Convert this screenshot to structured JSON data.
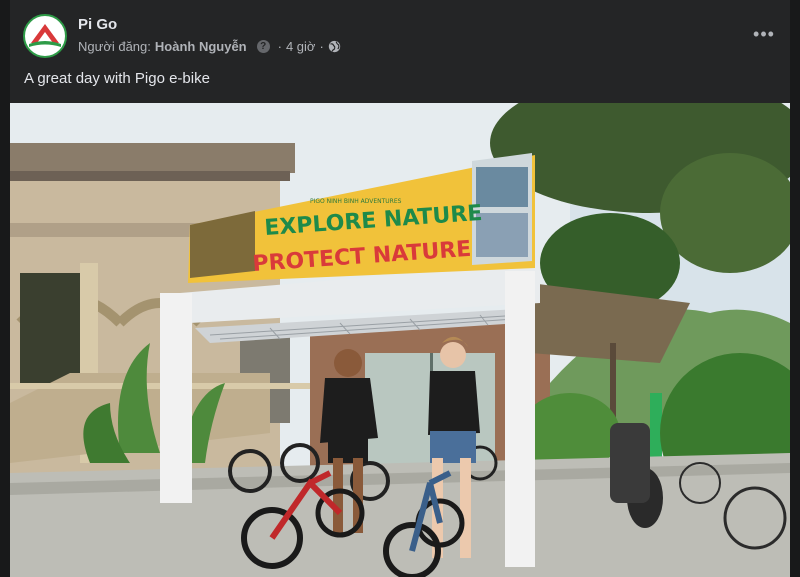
{
  "post": {
    "page_name": "Pi Go",
    "author_prefix": "Người đăng:",
    "author_name": "Hoành Nguyễn",
    "info_glyph": "?",
    "time": "4 giờ",
    "separator": "·",
    "audience_icon": "globe-icon",
    "more_glyph": "•••",
    "caption": "A great day with Pigo e-bike"
  },
  "photo": {
    "sign_line_1": "EXPLORE NATURE",
    "sign_line_2": "PROTECT NATURE",
    "sign_header": "PIGO NINH BINH ADVENTURES"
  },
  "colors": {
    "background": "#18191a",
    "card": "#242526",
    "primary_text": "#e4e6eb",
    "secondary_text": "#b0b3b8",
    "logo_green": "#2e9b47",
    "logo_red": "#d9383a"
  }
}
